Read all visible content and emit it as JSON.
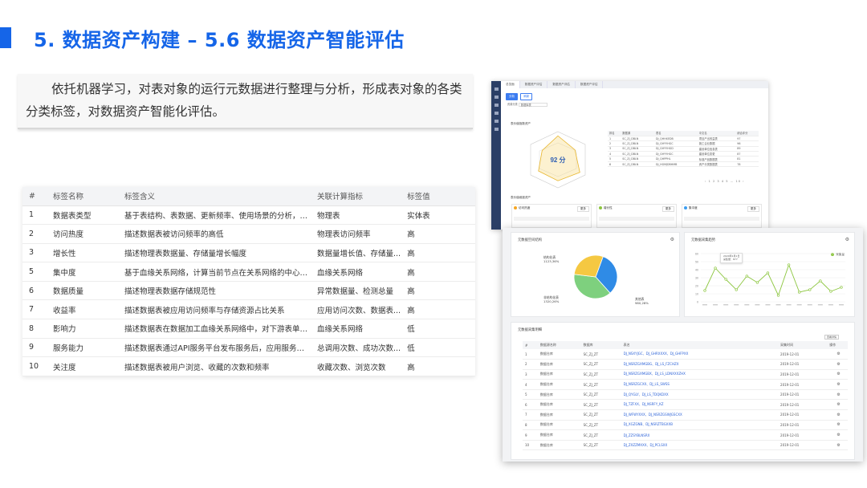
{
  "slide": {
    "title": "5. 数据资产构建 – 5.6 数据资产智能评估",
    "accent_color": "#1565e8",
    "description": "依托机器学习，对表对象的运行元数据进行整理与分析，形成表对象的各类分类标签，对数据资产智能化评估。"
  },
  "tag_table": {
    "columns": [
      "#",
      "标签名称",
      "标签含义",
      "关联计算指标",
      "标签值"
    ],
    "rows": [
      [
        "1",
        "数据表类型",
        "基于表结构、表数据、更新频率、使用场景的分析，自动识别...",
        "物理表",
        "实体表"
      ],
      [
        "2",
        "访问热度",
        "描述数据表被访问频率的高低",
        "物理表访问频率",
        "高"
      ],
      [
        "3",
        "增长性",
        "描述物理表数据量、存储量增长幅度",
        "数据量增长值、存储量...",
        "高"
      ],
      [
        "5",
        "集中度",
        "基于血缘关系网络，计算当前节点在关系网络的中心度。",
        "血缘关系网络",
        "高"
      ],
      [
        "6",
        "数据质量",
        "描述物理表数据存储规范性",
        "异常数据量、检测总量",
        "高"
      ],
      [
        "7",
        "收益率",
        "描述数据表被应用访问频率与存储资源占比关系",
        "应用访问次数、数据表...",
        "高"
      ],
      [
        "8",
        "影响力",
        "描述数据表在数据加工血缘关系网络中，对下游表单影响程度",
        "血缘关系网络",
        "低"
      ],
      [
        "9",
        "服务能力",
        "描述数据表通过API服务平台发布服务后，应用服务运行状况",
        "总调用次数、成功次数...",
        "低"
      ],
      [
        "10",
        "关注度",
        "描述数据表被用户浏览、收藏的次数和频率",
        "收藏次数、浏览次数",
        "高"
      ]
    ]
  },
  "back_app": {
    "tabs": [
      "总览面",
      "数据资产评估",
      "数据资产评估",
      "数据资产评估"
    ],
    "buttons": [
      "分析",
      "刷新"
    ],
    "select_label": "资源分类",
    "select_value": "数据库表",
    "radar_section": "表价值指数资产",
    "radar_score": "92 分",
    "table_headers": [
      "排名",
      "数据源",
      "表名",
      "中文名",
      "综合评分"
    ],
    "table_rows": [
      [
        "1",
        "SC_ZJ_DBLN",
        "DJ_QHHXEDB",
        "项目产出效益表",
        "97"
      ],
      [
        "2",
        "SC_ZJ_DBLN",
        "DJ_GHYYHGC",
        "施工企业数据",
        "96"
      ],
      [
        "3",
        "SC_ZJ_DBLN",
        "DJ_GHYYHGD",
        "建设单位信息表",
        "89"
      ],
      [
        "4",
        "SC_ZJ_DBLN",
        "DJ_GHYYHGC",
        "建设单位变更",
        "87"
      ],
      [
        "5",
        "SC_ZJ_DBLN",
        "DJ_QHPPHL",
        "标准产品数据表",
        "81"
      ],
      [
        "6",
        "SC_ZJ_DBLN",
        "DJ_HGMJDBHMB",
        "资产分类数据表",
        "78"
      ]
    ],
    "pager": "‹ 1 2 3 4 5 … 10 ›",
    "cards_section": "表价值维度资产",
    "sub_cards": [
      {
        "label": "访问热度",
        "more": "更多",
        "color": "#f5a623"
      },
      {
        "label": "增长性",
        "more": "更多",
        "color": "#8cc63f"
      },
      {
        "label": "集中度",
        "more": "更多",
        "color": "#3c9df0"
      }
    ]
  },
  "front_app": {
    "pie_title": "元数据空间结构",
    "pie_labels": [
      {
        "name": "结构化表",
        "value": "1123,36%"
      },
      {
        "name": "非结构化表",
        "value": "1320,26%"
      },
      {
        "name": "其他表",
        "value": "980,28%"
      }
    ],
    "line_title": "元数据采集趋势",
    "legend": "采集量",
    "tooltip": [
      "2020年1月1日",
      "采集量：877"
    ],
    "table_title": "元数据采集明细",
    "table_headers": [
      "#",
      "数据源名称",
      "数据库",
      "表名",
      "采集时间",
      "操作"
    ],
    "tip": "查看详情",
    "table_rows": [
      [
        "1",
        "数据仓库",
        "SC_ZJ_ZT",
        "DJ_NSXYJGC、DJ_GHRXXXX、DJ_GHFPXX",
        "2019-12-01"
      ],
      [
        "2",
        "数据仓库",
        "SC_ZJ_ZT",
        "DJ_NSRZGXMGBG、DJ_LS_FZCHZX",
        "2019-12-01"
      ],
      [
        "3",
        "数据仓库",
        "SC_ZJ_ZT",
        "DJ_NSRZGXMGBX、DJ_LS_LDNXXXZHX",
        "2019-12-01"
      ],
      [
        "4",
        "数据仓库",
        "SC_ZJ_ZT",
        "DJ_NSRZGCXX、DJ_LS_SWSS",
        "2019-12-01"
      ],
      [
        "5",
        "数据仓库",
        "SC_ZJ_ZT",
        "DJ_QYGLY、DJ_LS_TDQKDXX",
        "2019-12-01"
      ],
      [
        "6",
        "数据仓库",
        "SC_ZJ_ZT",
        "DJ_TZFXX、DJ_NSRFY_KZ",
        "2019-12-01"
      ],
      [
        "7",
        "数据仓库",
        "SC_ZJ_ZT",
        "DJ_WFWYXXX、DJ_NSRZGSWJGSCXX",
        "2019-12-01"
      ],
      [
        "8",
        "数据仓库",
        "SC_ZJ_ZT",
        "DJ_XGZGNB、DJ_NSRZTBGXXB",
        "2019-12-01"
      ],
      [
        "9",
        "数据仓库",
        "SC_ZJ_ZT",
        "DJ_ZZSYBLNSRX",
        "2019-12-01"
      ],
      [
        "10",
        "数据仓库",
        "SC_ZJ_ZT",
        "DJ_ZXZZMXXX、DJ_PCLSXX",
        "2019-12-01"
      ]
    ]
  },
  "chart_data": [
    {
      "type": "pie",
      "title": "元数据空间结构",
      "categories": [
        "结构化表",
        "非结构化表",
        "其他表"
      ],
      "values": [
        1123,
        1320,
        980
      ],
      "colors": [
        "#2f8be6",
        "#7ed07e",
        "#f5c842"
      ]
    },
    {
      "type": "line",
      "title": "元数据采集趋势",
      "series": [
        {
          "name": "采集量",
          "values": [
            14,
            42,
            28,
            15,
            32,
            24,
            36,
            8,
            46,
            12,
            15,
            26,
            13,
            18
          ]
        }
      ],
      "ylim": [
        0,
        60
      ],
      "yticks": [
        "0",
        "10",
        "20",
        "30",
        "40",
        "50",
        "60"
      ],
      "color": "#8cc63f"
    },
    {
      "type": "radar",
      "title": "表价值指数资产",
      "score": "92 分",
      "values": [
        0.85,
        0.7,
        0.9,
        0.75,
        0.8,
        0.65
      ]
    }
  ]
}
